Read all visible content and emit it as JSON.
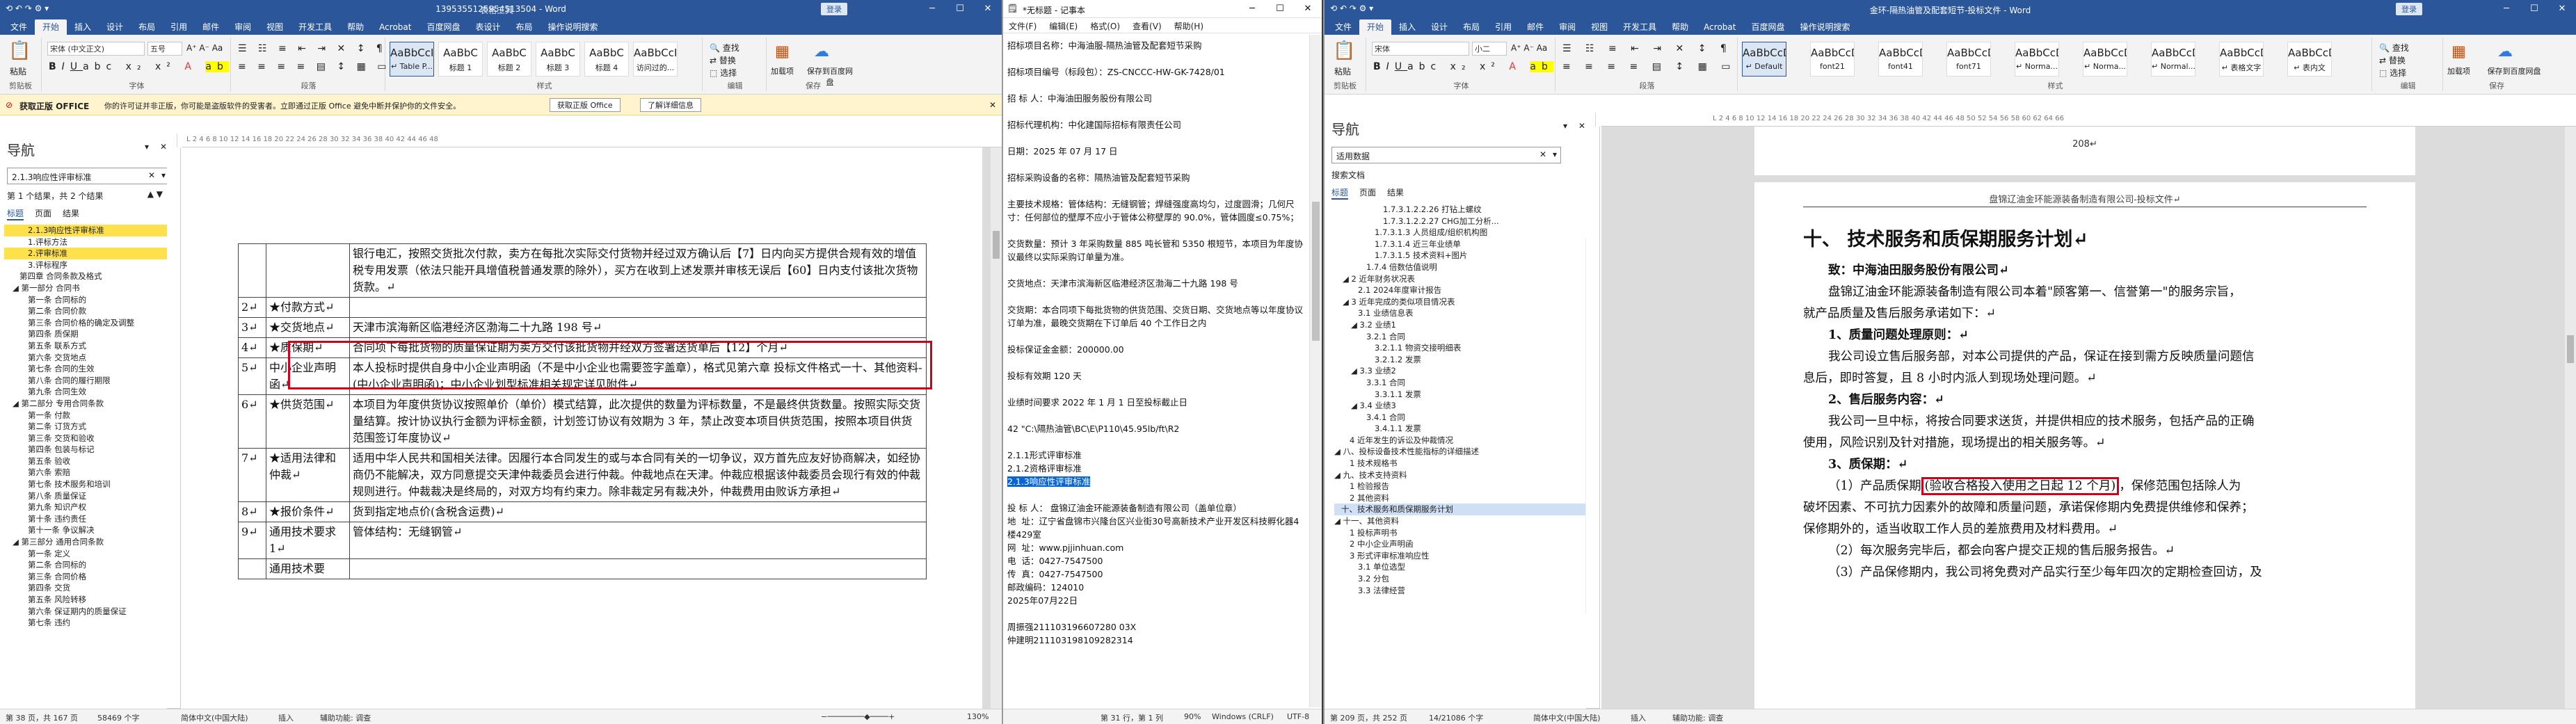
{
  "w1": {
    "quick_access": "⟲ ↶ ↷ ⚙ ▾",
    "context_tab": "表格工具",
    "title": "1395355125954513504 - Word",
    "login": "登录",
    "tabs": [
      "文件",
      "开始",
      "插入",
      "设计",
      "布局",
      "引用",
      "邮件",
      "审阅",
      "视图",
      "开发工具",
      "帮助",
      "Acrobat",
      "百度网盘",
      "表设计",
      "布局",
      "操作说明搜索"
    ],
    "active_tab": "开始",
    "ribbon": {
      "paste": "粘贴",
      "clipboard": "剪贴板",
      "font_name": "宋体 (中文正文)",
      "font_size": "五号",
      "font_group": "字体",
      "para_group": "段落",
      "styles": [
        {
          "preview": "AaBbCcI",
          "name": "↵ Table P..."
        },
        {
          "preview": "AaBbC",
          "name": "标题 1"
        },
        {
          "preview": "AaBbC",
          "name": "标题 2"
        },
        {
          "preview": "AaBbC",
          "name": "标题 3"
        },
        {
          "preview": "AaBbC",
          "name": "标题 4"
        },
        {
          "preview": "AaBbCcI",
          "name": "访问过的..."
        }
      ],
      "style_group": "样式",
      "find": "查找",
      "replace": "替换",
      "select": "选择",
      "edit_group": "编辑",
      "addin": "加载项",
      "save_baidu": "保存到百度网盘",
      "save_group": "保存"
    },
    "infobar": {
      "label": "获取正版 OFFICE",
      "message": "你的许可证并非正版，你可能是盗版软件的受害者。立即通过正版 Office 避免中断并保护你的文件安全。",
      "btn1": "获取正版 Office",
      "btn2": "了解详细信息"
    },
    "nav": {
      "title": "导航",
      "search": "2.1.3响应性评审标准",
      "results": "第 1 个结果，共 2 个结果",
      "tabs": [
        "标题",
        "页面",
        "结果"
      ],
      "tree": [
        {
          "t": "2.1.3响应性评审标准",
          "lv": 2,
          "hl": true
        },
        {
          "t": "1.评标方法",
          "lv": 2
        },
        {
          "t": "2.评审标准",
          "lv": 2,
          "hl": true
        },
        {
          "t": "3.评标程序",
          "lv": 2
        },
        {
          "t": "第四章 合同条款及格式",
          "lv": 1
        },
        {
          "t": "第一部分 合同书",
          "lv": 1,
          "exp": true
        },
        {
          "t": "第一条 合同标的",
          "lv": 2
        },
        {
          "t": "第二条 合同价款",
          "lv": 2
        },
        {
          "t": "第三条 合同价格的确定及调整",
          "lv": 2
        },
        {
          "t": "第四条 质保期",
          "lv": 2
        },
        {
          "t": "第五条 联系方式",
          "lv": 2
        },
        {
          "t": "第六条 交货地点",
          "lv": 2
        },
        {
          "t": "第七条 合同的生效",
          "lv": 2
        },
        {
          "t": "第八条 合同的履行期限",
          "lv": 2
        },
        {
          "t": "第九条 合同生效",
          "lv": 2
        },
        {
          "t": "第二部分 专用合同条款",
          "lv": 1,
          "exp": true
        },
        {
          "t": "第一条 付款",
          "lv": 2
        },
        {
          "t": "第二条 订货方式",
          "lv": 2
        },
        {
          "t": "第三条 交货和验收",
          "lv": 2
        },
        {
          "t": "第四条 包装与标记",
          "lv": 2
        },
        {
          "t": "第五条 验收",
          "lv": 2
        },
        {
          "t": "第六条 索赔",
          "lv": 2
        },
        {
          "t": "第七条 技术服务和培训",
          "lv": 2
        },
        {
          "t": "第八条 质量保证",
          "lv": 2
        },
        {
          "t": "第九条 知识产权",
          "lv": 2
        },
        {
          "t": "第十条 违约责任",
          "lv": 2
        },
        {
          "t": "第十一条 争议解决",
          "lv": 2
        },
        {
          "t": "第三部分 通用合同条款",
          "lv": 1,
          "exp": true
        },
        {
          "t": "第一条 定义",
          "lv": 2
        },
        {
          "t": "第二条 合同标的",
          "lv": 2
        },
        {
          "t": "第三条 合同价格",
          "lv": 2
        },
        {
          "t": "第四条 交货",
          "lv": 2
        },
        {
          "t": "第五条 风险转移",
          "lv": 2
        },
        {
          "t": "第六条 保证期内的质量保证",
          "lv": 2
        },
        {
          "t": "第七条 违约",
          "lv": 2
        }
      ]
    },
    "ruler": "L 2 4 6 8 10 12 14 16 18 20 22 24 26 28 30 32 34 36 38 40 42 44 46 48",
    "table": [
      {
        "num": "",
        "name": "",
        "content": "银行电汇，按照交货批次付款，卖方在每批次实际交付货物并经过双方确认后【7】日内向买方提供合规有效的增值税专用发票（依法只能开具增值税普通发票的除外），买方在收到上述发票并审核无误后【60】日内支付该批次货物货款。↵"
      },
      {
        "num": "2↵",
        "name": "★付款方式↵",
        "content": ""
      },
      {
        "num": "3↵",
        "name": "★交货地点↵",
        "content": "天津市滨海新区临港经济区渤海二十九路 198 号↵"
      },
      {
        "num": "4↵",
        "name": "★质保期↵",
        "content": "合同项下每批货物的质量保证期为卖方交付该批货物并经双方签署送货单后【12】个月↵"
      },
      {
        "num": "5↵",
        "name": "中小企业声明函↵",
        "content": "本人投标时提供自身中小企业声明函（不是中小企业也需要签字盖章），格式见第六章 投标文件格式一十、其他资料-(中小企业声明函)；中小企业划型标准相关规定详见附件↵"
      },
      {
        "num": "6↵",
        "name": "★供货范围↵",
        "content": "本项目为年度供货协议按照单价（单价）模式结算，此次提供的数量为评标数量，不是最终供货数量。按照实际交货量结算。按计协议执行金额为评标金额，计划签订协议有效期为 3 年，禁止改变本项目供货范围，按照本项目供货范围签订年度协议↵"
      },
      {
        "num": "7↵",
        "name": "★适用法律和仲裁↵",
        "content": "适用中华人民共和国相关法律。因履行本合同发生的或与本合同有关的一切争议，双方首先应友好协商解决，如经协商仍不能解决，双方同意提交天津仲裁委员会进行仲裁。仲裁地点在天津。仲裁应根据该仲裁委员会现行有效的仲裁规则进行。仲裁裁决是终局的，对双方均有约束力。除非裁定另有裁决外，仲裁费用由败诉方承担↵"
      },
      {
        "num": "8↵",
        "name": "★报价条件↵",
        "content": "货到指定地点价(含税含运费)↵"
      },
      {
        "num": "9↵",
        "name": "通用技术要求 1↵",
        "content": "管体结构：无缝钢管↵"
      },
      {
        "num": "",
        "name": "通用技术要",
        "content": ""
      }
    ],
    "status": {
      "page": "第 38 页，共 167 页",
      "words": "58469 个字",
      "lang": "简体中文(中国大陆)",
      "insert": "插入",
      "a11y": "辅助功能: 调查",
      "zoom": "130%"
    }
  },
  "w2": {
    "title": "*无标题 - 记事本",
    "menu": [
      "文件(F)",
      "编辑(E)",
      "格式(O)",
      "查看(V)",
      "帮助(H)"
    ],
    "lines": [
      "招标项目名称：中海油服-隔热油管及配套短节采购",
      "",
      "招标项目编号（标段包）：ZS-CNCCC-HW-GK-7428/01",
      "",
      "招 标 人：中海油田服务股份有限公司",
      "",
      "招标代理机构：中化建国际招标有限责任公司",
      "",
      "日期：2025 年 07 月 17 日",
      "",
      "招标采购设备的名称：隔热油管及配套短节采购",
      "",
      "主要技术规格：管体结构：无缝钢管；焊缝强度高均匀，过度圆滑；几何尺寸：任何部位的壁厚不应小于管体公称壁厚的 90.0%，管体圆度≤0.75%；",
      "",
      "交货数量：预计 3 年采购数量 885 吨长管和 5350 根短节，本项目为年度协议最终以实际采购订单量为准。",
      "",
      "交货地点：天津市滨海新区临港经济区渤海二十九路 198 号",
      "",
      "交货期：本合同项下每批货物的供货范围、交货日期、交货地点等以年度协议订单为准，最晚交货期在下订单后 40 个工作日之内",
      "",
      "投标保证金金额：200000.00",
      "",
      "投标有效期 120 天",
      "",
      "业绩时间要求 2022 年 1 月 1 日至投标截止日",
      "",
      "42 \"C:\\隔热油管\\BC\\E\\P110\\45.95lb/ft\\R2",
      "",
      "2.1.1形式评审标准",
      "2.1.2资格评审标准",
      "2.1.3响应性评审标准",
      "",
      "投 标 人： 盘锦辽油金环能源装备制造有限公司（盖单位章）",
      "地  址：辽宁省盘锦市兴隆台区兴业街30号高新技术产业开发区科技孵化器4楼429室",
      "网  址：www.pjjinhuan.com",
      "电  话：0427-7547500",
      "传  真：0427-7547500",
      "邮政编码：124010",
      "2025年07月22日",
      "",
      "周振强211103196607280 03X",
      "仲建明211103198109282314"
    ],
    "selected_line": "2.1.3响应性评审标准",
    "status": {
      "pos": "第 31 行，第 1 列",
      "zoom": "90%",
      "eol": "Windows (CRLF)",
      "enc": "UTF-8"
    }
  },
  "w3": {
    "quick_access": "⟲ ↶ ↷ ⚙ ▾",
    "title": "金环-隔热油管及配套短节-投标文件 - Word",
    "login": "登录",
    "tabs": [
      "文件",
      "开始",
      "插入",
      "设计",
      "布局",
      "引用",
      "邮件",
      "审阅",
      "视图",
      "开发工具",
      "帮助",
      "Acrobat",
      "百度网盘",
      "操作说明搜索"
    ],
    "active_tab": "开始",
    "ribbon": {
      "paste": "粘贴",
      "clipboard": "剪贴板",
      "font_name": "宋体",
      "font_size": "小二",
      "font_group": "字体",
      "para_group": "段落",
      "styles": [
        {
          "preview": "AaBbCcD",
          "name": "↵ Default"
        },
        {
          "preview": "AaBbCcDd",
          "name": "font21"
        },
        {
          "preview": "AaBbCcDd",
          "name": "font41"
        },
        {
          "preview": "AaBbCcDd",
          "name": "font71"
        },
        {
          "preview": "AaBbCcDd",
          "name": "↵ Norma..."
        },
        {
          "preview": "AaBbCcDd",
          "name": "↵ Norma..."
        },
        {
          "preview": "AaBbCcDd",
          "name": "↵ Normal..."
        },
        {
          "preview": "AaBbCcDd",
          "name": "↵ 表格文字"
        },
        {
          "preview": "AaBbCcDd",
          "name": "↵ 表内文"
        }
      ],
      "style_group": "样式",
      "find": "查找",
      "replace": "替换",
      "select": "选择",
      "edit_group": "编辑",
      "addin": "加载项",
      "save_baidu": "保存到百度网盘",
      "save_group": "保存"
    },
    "nav": {
      "title": "导航",
      "search": "适用数据",
      "search_doc": "搜索文档",
      "tabs": [
        "标题",
        "页面",
        "结果"
      ],
      "tree": [
        {
          "t": "1.7.3.1.2.2.26 打钻上螺纹",
          "lv": 5
        },
        {
          "t": "1.7.3.1.2.2.27 CHG加工分析...",
          "lv": 5
        },
        {
          "t": "1.7.3.1.3 人员组成/组织机构图",
          "lv": 4
        },
        {
          "t": "1.7.3.1.4 近三年业绩单",
          "lv": 4
        },
        {
          "t": "1.7.3.1.5 技术资料+图片",
          "lv": 4
        },
        {
          "t": "1.7.4 倍数估值说明",
          "lv": 3
        },
        {
          "t": "2 近年财务状况表",
          "lv": 1,
          "exp": true
        },
        {
          "t": "2.1 2024年度审计报告",
          "lv": 2
        },
        {
          "t": "3 近年完成的类似项目情况表",
          "lv": 1,
          "exp": true
        },
        {
          "t": "3.1 业绩信息表",
          "lv": 2
        },
        {
          "t": "3.2 业绩1",
          "lv": 2,
          "exp": true
        },
        {
          "t": "3.2.1 合同",
          "lv": 3
        },
        {
          "t": "3.2.1.1 物资交接明细表",
          "lv": 4
        },
        {
          "t": "3.2.1.2 发票",
          "lv": 4
        },
        {
          "t": "3.3 业绩2",
          "lv": 2,
          "exp": true
        },
        {
          "t": "3.3.1 合同",
          "lv": 3
        },
        {
          "t": "3.3.1.1 发票",
          "lv": 4
        },
        {
          "t": "3.4 业绩3",
          "lv": 2,
          "exp": true
        },
        {
          "t": "3.4.1 合同",
          "lv": 3
        },
        {
          "t": "3.4.1.1 发票",
          "lv": 4
        },
        {
          "t": "4 近年发生的诉讼及仲裁情况",
          "lv": 1
        },
        {
          "t": "八、投标设备技术性能指标的详细描述",
          "lv": 0,
          "exp": true
        },
        {
          "t": "1 技术规格书",
          "lv": 1
        },
        {
          "t": "九、技术支持资料",
          "lv": 0,
          "exp": true
        },
        {
          "t": "1 检验报告",
          "lv": 1
        },
        {
          "t": "2 其他资料",
          "lv": 1
        },
        {
          "t": "十、技术服务和质保期服务计划",
          "lv": 0,
          "cur": true
        },
        {
          "t": "十一、其他资料",
          "lv": 0,
          "exp": true
        },
        {
          "t": "1 投标声明书",
          "lv": 1
        },
        {
          "t": "2 中小企业声明函",
          "lv": 1
        },
        {
          "t": "3 形式评审标准响应性",
          "lv": 1
        },
        {
          "t": "3.1 单位选型",
          "lv": 2
        },
        {
          "t": "3.2 分包",
          "lv": 2
        },
        {
          "t": "3.3 法律经营",
          "lv": 2
        }
      ]
    },
    "ruler": "L 2 4 6 8 10 12 14 16 18 20 22 24 26 28 30 32 34 36 38 40 42 44 46 48 50 52 54 56 58 60 62 64 66",
    "doc": {
      "page_num": "208↵",
      "header": "盘锦辽油金环能源装备制造有限公司-投标文件↵",
      "heading": "十、 技术服务和质保期服务计划↵",
      "to": "致：中海油田服务股份有限公司↵",
      "p1": "盘锦辽油金环能源装备制造有限公司本着\"顾客第一、信誉第一\"的服务宗旨，",
      "p1b": "就产品质量及售后服务承诺如下：↵",
      "h1": "1、质量问题处理原则：↵",
      "p2": "我公司设立售后服务部，对本公司提供的产品，保证在接到需方反映质量问题信",
      "p2b": "息后，即时答复，且 8 小时内派人到现场处理问题。↵",
      "h2": "2、售后服务内容：↵",
      "p3": "我公司一旦中标，将按合同要求送货，并提供相应的技术服务，包括产品的正确",
      "p3b": "使用，风险识别及针对措施，现场提出的相关服务等。↵",
      "h3": "3、质保期：↵",
      "p4a": "（1）产品质保期",
      "p4box": "(验收合格投入使用之日起 12 个月)",
      "p4c": "，保修范围包括除人为",
      "p4d": "破坏因素、不可抗力因素外的故障和质量问题，承诺保修期内免费提供维修和保养；",
      "p4e": "保修期外的，适当收取工作人员的差旅费用及材料费用。↵",
      "p5": "（2）每次服务完毕后，都会向客户提交正规的售后服务报告。↵",
      "p6": "（3）产品保修期内，我公司将免费对产品实行至少每年四次的定期检查回访，及"
    },
    "status": {
      "page": "第 209 页，共 252 页",
      "words": "14/21086 个字",
      "lang": "简体中文(中国大陆)",
      "insert": "插入",
      "a11y": "辅助功能: 调查"
    }
  }
}
